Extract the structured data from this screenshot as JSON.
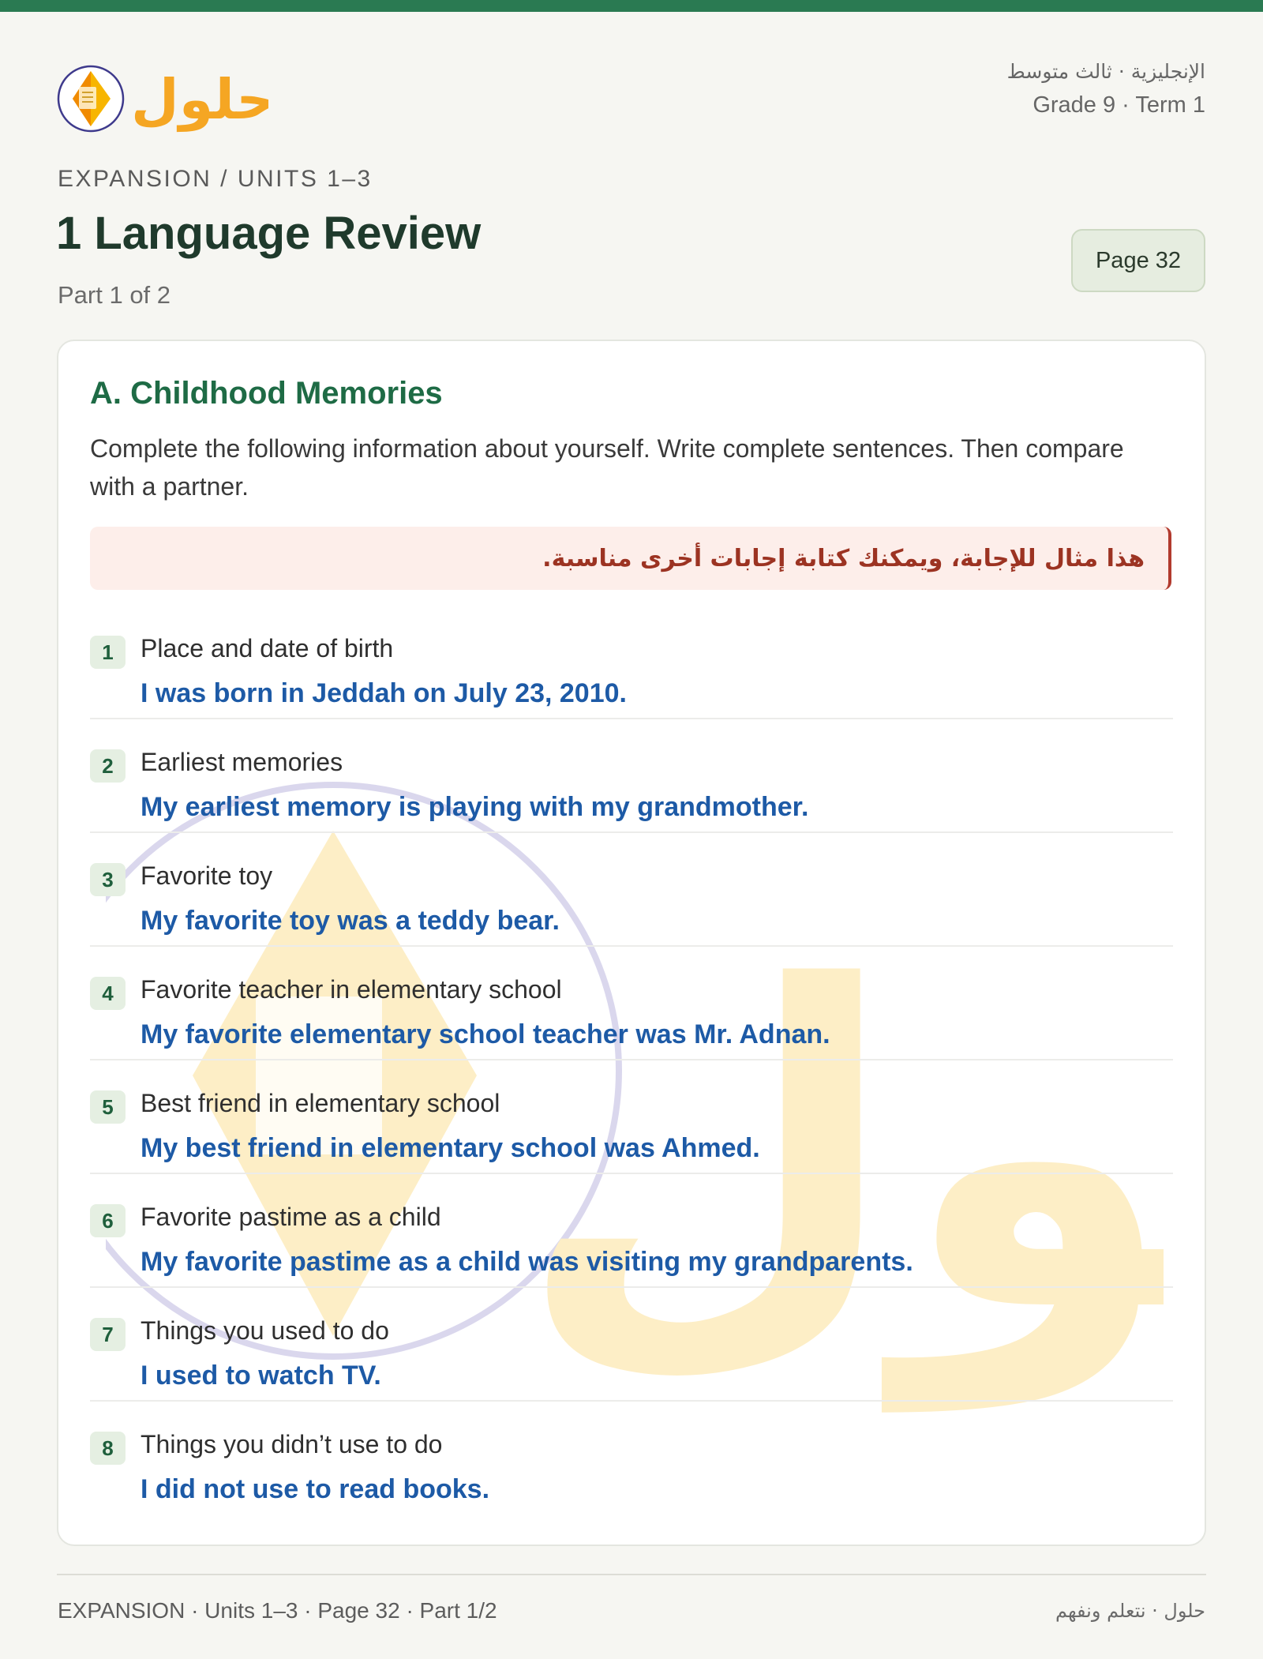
{
  "header": {
    "logo_text": "حلول",
    "subject_arabic": "الإنجليزية · ثالث متوسط",
    "grade_term": "Grade 9 · Term 1"
  },
  "kicker": "EXPANSION / UNITS 1–3",
  "title": "1 Language Review",
  "part": "Part 1 of 2",
  "page_badge": "Page 32",
  "section": {
    "title": "A. Childhood Memories",
    "instructions": "Complete the following information about yourself. Write complete sentences. Then compare with a partner.",
    "note": "هذا مثال للإجابة، ويمكنك كتابة إجابات أخرى مناسبة."
  },
  "items": [
    {
      "num": "1",
      "prompt": "Place and date of birth",
      "answer": "I was born in Jeddah on July 23, 2010."
    },
    {
      "num": "2",
      "prompt": "Earliest memories",
      "answer": "My earliest memory is playing with my grandmother."
    },
    {
      "num": "3",
      "prompt": "Favorite toy",
      "answer": "My favorite toy was a teddy bear."
    },
    {
      "num": "4",
      "prompt": "Favorite teacher in elementary school",
      "answer": "My favorite elementary school teacher was Mr. Adnan."
    },
    {
      "num": "5",
      "prompt": "Best friend in elementary school",
      "answer": "My best friend in elementary school was Ahmed."
    },
    {
      "num": "6",
      "prompt": "Favorite pastime as a child",
      "answer": "My favorite pastime as a child was visiting my grandparents."
    },
    {
      "num": "7",
      "prompt": "Things you used to do",
      "answer": "I used to watch TV."
    },
    {
      "num": "8",
      "prompt": "Things you didn’t use to do",
      "answer": "I did not use to read books."
    }
  ],
  "footer": {
    "left": "EXPANSION · Units 1–3 · Page 32 · Part 1/2",
    "right": "حلول · نتعلم ونفهم"
  },
  "colors": {
    "top_bar": "#2a7a52",
    "section_title": "#1e6b45",
    "answer": "#1d5aa6",
    "note_text": "#9c3322",
    "logo_orange": "#f5a623"
  }
}
